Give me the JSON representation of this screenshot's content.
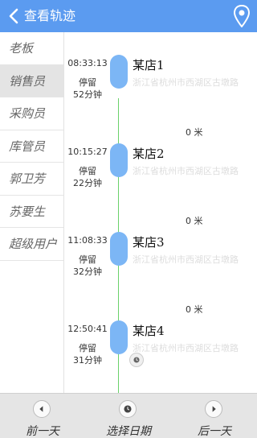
{
  "header": {
    "title": "查看轨迹",
    "back_icon": "chevron-left-icon",
    "location_icon": "map-pin-icon"
  },
  "sidebar": {
    "items": [
      {
        "label": "老板",
        "active": false
      },
      {
        "label": "销售员",
        "active": true
      },
      {
        "label": "采购员",
        "active": false
      },
      {
        "label": "库管员",
        "active": false
      },
      {
        "label": "郭卫芳",
        "active": false
      },
      {
        "label": "苏要生",
        "active": false
      },
      {
        "label": "超级用户",
        "active": false
      }
    ]
  },
  "timeline": {
    "stops": [
      {
        "time": "08:33:13",
        "status": "停留",
        "duration": "52分钟",
        "name": "某店1",
        "address": "浙江省杭州市西湖区古墩路"
      },
      {
        "time": "10:15:27",
        "status": "停留",
        "duration": "22分钟",
        "name": "某店2",
        "address": "浙江省杭州市西湖区古墩路"
      },
      {
        "time": "11:08:33",
        "status": "停留",
        "duration": "32分钟",
        "name": "某店3",
        "address": "浙江省杭州市西湖区古墩路"
      },
      {
        "time": "12:50:41",
        "status": "停留",
        "duration": "31分钟",
        "name": "某店4",
        "address": "浙江省杭州市西湖区古墩路"
      }
    ],
    "distances": [
      "0 米",
      "0 米",
      "0 米"
    ]
  },
  "bottom": {
    "prev_day": "前一天",
    "select_date": "选择日期",
    "next_day": "后一天"
  },
  "colors": {
    "header": "#5b9bf0",
    "marker": "#7cb6f5",
    "timeline_line": "#6ad16a"
  }
}
